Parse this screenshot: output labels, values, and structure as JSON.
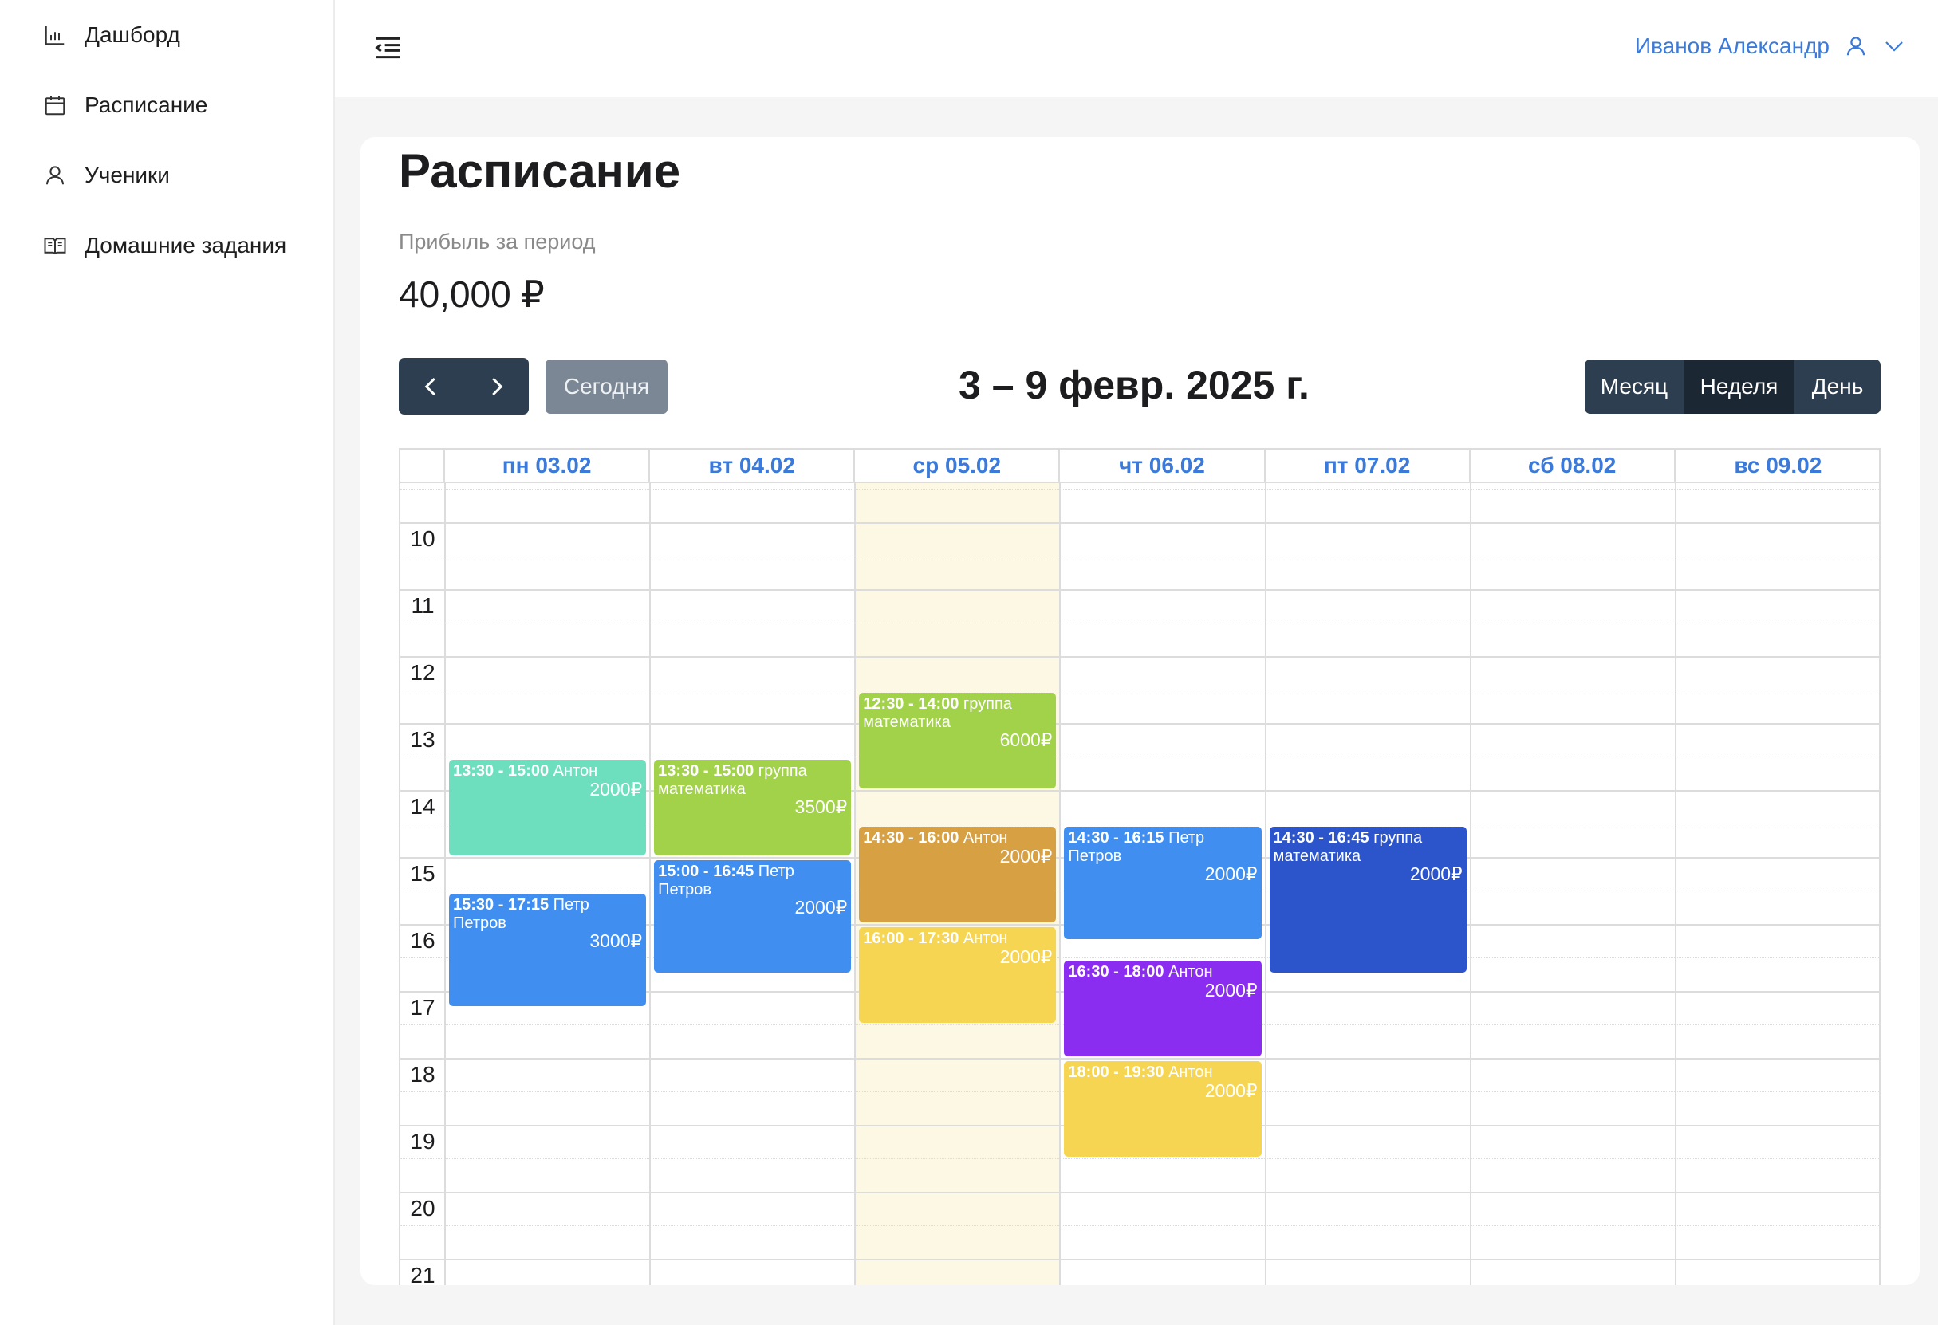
{
  "sidebar": {
    "items": [
      {
        "label": "Дашборд",
        "icon": "bar-chart-icon"
      },
      {
        "label": "Расписание",
        "icon": "calendar-icon"
      },
      {
        "label": "Ученики",
        "icon": "user-icon"
      },
      {
        "label": "Домашние задания",
        "icon": "book-icon"
      }
    ]
  },
  "header": {
    "user_name": "Иванов Александр",
    "menu_icon": "menu-fold-icon",
    "user_icon": "user-icon",
    "dropdown_icon": "chevron-down-icon"
  },
  "page": {
    "title": "Расписание",
    "profit_label": "Прибыль за период",
    "profit_value": "40,000 ₽"
  },
  "toolbar": {
    "prev_icon": "chevron-left-icon",
    "next_icon": "chevron-right-icon",
    "today_label": "Сегодня",
    "period_title": "3 – 9 февр. 2025 г.",
    "views": [
      {
        "label": "Месяц",
        "active": false
      },
      {
        "label": "Неделя",
        "active": true
      },
      {
        "label": "День",
        "active": false
      }
    ]
  },
  "calendar": {
    "days": [
      "пн 03.02",
      "вт 04.02",
      "ср 05.02",
      "чт 06.02",
      "пт 07.02",
      "сб 08.02",
      "вс 09.02"
    ],
    "today_index": 2,
    "hours": [
      "10",
      "11",
      "12",
      "13",
      "14",
      "15",
      "16",
      "17",
      "18",
      "19",
      "20",
      "21"
    ],
    "events": [
      {
        "day": 0,
        "start": 13.5,
        "end": 15.0,
        "time": "13:30 - 15:00",
        "title": "Антон",
        "price": "2000₽",
        "color": "#6ddfbf"
      },
      {
        "day": 0,
        "start": 15.5,
        "end": 17.25,
        "time": "15:30 - 17:15",
        "title": "Петр Петров",
        "price": "3000₽",
        "color": "#3f8ef0"
      },
      {
        "day": 1,
        "start": 13.5,
        "end": 15.0,
        "time": "13:30 - 15:00",
        "title": "группа математика",
        "price": "3500₽",
        "color": "#a2d14a"
      },
      {
        "day": 1,
        "start": 15.0,
        "end": 16.75,
        "time": "15:00 - 16:45",
        "title": "Петр Петров",
        "price": "2000₽",
        "color": "#3f8ef0"
      },
      {
        "day": 2,
        "start": 12.5,
        "end": 14.0,
        "time": "12:30 - 14:00",
        "title": "группа математика",
        "price": "6000₽",
        "color": "#a2d14a"
      },
      {
        "day": 2,
        "start": 14.5,
        "end": 16.0,
        "time": "14:30 - 16:00",
        "title": "Антон",
        "price": "2000₽",
        "color": "#d7a043"
      },
      {
        "day": 2,
        "start": 16.0,
        "end": 17.5,
        "time": "16:00 - 17:30",
        "title": "Антон",
        "price": "2000₽",
        "color": "#f6d552"
      },
      {
        "day": 3,
        "start": 14.5,
        "end": 16.25,
        "time": "14:30 - 16:15",
        "title": "Петр Петров",
        "price": "2000₽",
        "color": "#3f8ef0"
      },
      {
        "day": 3,
        "start": 16.5,
        "end": 18.0,
        "time": "16:30 - 18:00",
        "title": "Антон",
        "price": "2000₽",
        "color": "#8a2df0"
      },
      {
        "day": 3,
        "start": 18.0,
        "end": 19.5,
        "time": "18:00 - 19:30",
        "title": "Антон",
        "price": "2000₽",
        "color": "#f6d552"
      },
      {
        "day": 4,
        "start": 14.5,
        "end": 16.75,
        "time": "14:30 - 16:45",
        "title": "группа математика",
        "price": "2000₽",
        "color": "#2c55cc"
      }
    ]
  },
  "colors": {
    "accent": "#3b7ad9",
    "dark_button": "#2c3e50",
    "today_button": "#7b8794",
    "today_column": "#fdf8e4"
  }
}
